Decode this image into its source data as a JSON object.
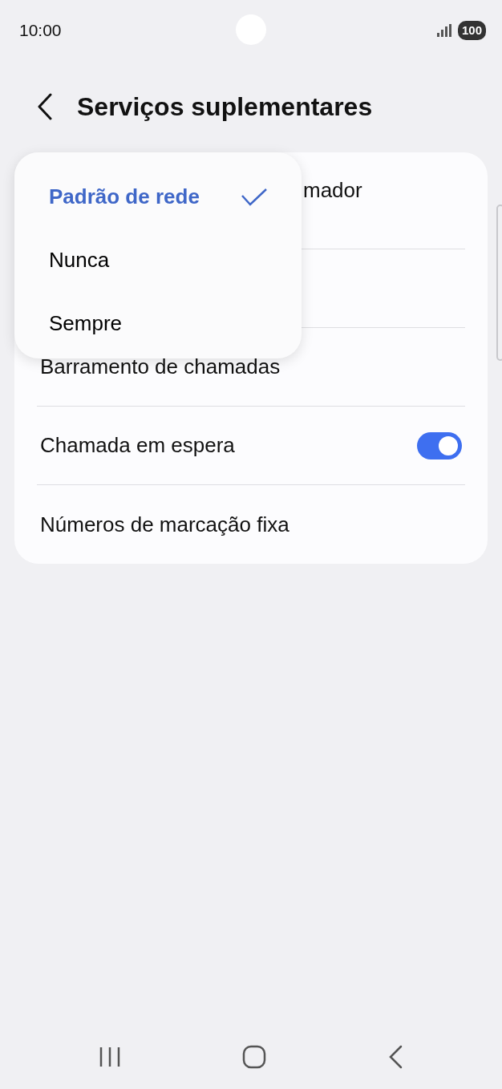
{
  "status_bar": {
    "time": "10:00",
    "battery": "100"
  },
  "header": {
    "title": "Serviços suplementares"
  },
  "settings": [
    {
      "kind": "partial",
      "label": "mador"
    },
    {
      "kind": "plain",
      "label": "Barramento de chamadas"
    },
    {
      "kind": "switch",
      "label": "Chamada em espera",
      "on": true
    },
    {
      "kind": "plain",
      "label": "Números de marcação fixa"
    }
  ],
  "menu": [
    {
      "label": "Padrão de rede",
      "selected": true
    },
    {
      "label": "Nunca",
      "selected": false
    },
    {
      "label": "Sempre",
      "selected": false
    }
  ]
}
